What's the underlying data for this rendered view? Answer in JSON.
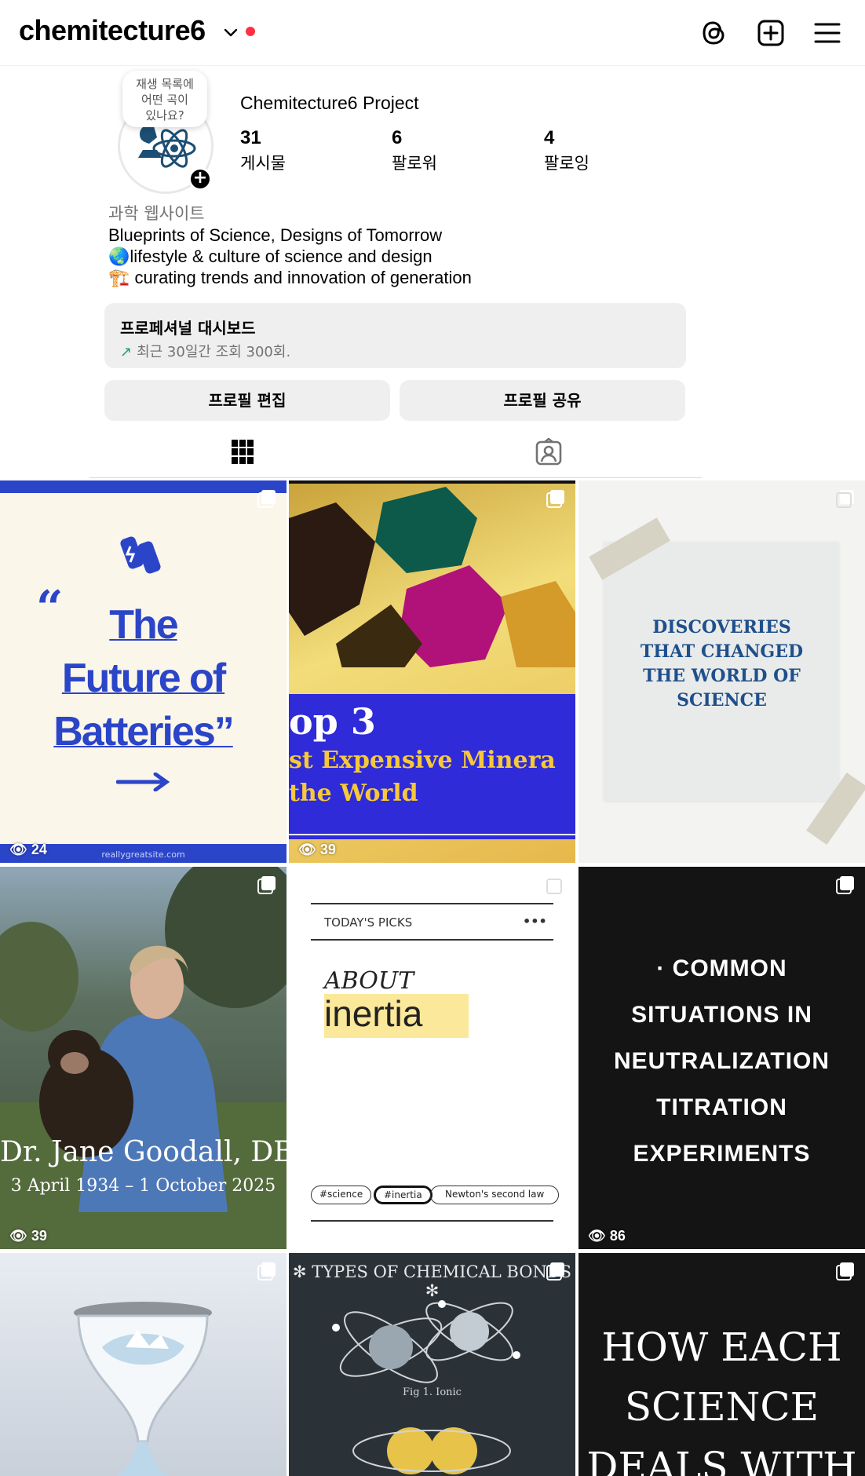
{
  "header": {
    "username": "chemitecture6",
    "icons": [
      "chevron-down-icon",
      "threads-icon",
      "create-icon",
      "menu-icon"
    ]
  },
  "profile": {
    "note": "재생 목록에\n어떤 곡이\n있나요?",
    "display_name": "Chemitecture6 Project",
    "stats": [
      {
        "value": "31",
        "label": "게시물"
      },
      {
        "value": "6",
        "label": "팔로워"
      },
      {
        "value": "4",
        "label": "팔로잉"
      }
    ],
    "category": "과학 웹사이트",
    "bio": [
      "Blueprints of Science, Designs of Tomorrow",
      "🌏lifestyle & culture of science and design",
      "🏗️ curating trends and innovation of generation"
    ]
  },
  "dashboard": {
    "title": "프로페셔널 대시보드",
    "subtitle": "최근 30일간 조회 300회."
  },
  "buttons": {
    "edit": "프로필 편집",
    "share": "프로필 공유"
  },
  "tabs": [
    "grid-icon",
    "tagged-icon"
  ],
  "posts": [
    {
      "views": "24",
      "lines": [
        "The",
        "Future of",
        "Batteries”"
      ],
      "quote": "“",
      "footer": "reallygreatsite.com"
    },
    {
      "views": "39",
      "lines": [
        "op 3",
        "st Expensive Minera",
        "the World"
      ]
    },
    {
      "views": "",
      "lines": [
        "DISCOVERIES",
        "THAT CHANGED",
        "THE WORLD OF",
        "SCIENCE"
      ]
    },
    {
      "views": "39",
      "lines": [
        "Dr. Jane Goodall, DBE",
        "3 April 1934 – 1 October 2025"
      ]
    },
    {
      "views": "",
      "kicker": "TODAY'S PICKS",
      "more": "•••",
      "about": "ABOUT",
      "word": "inertia",
      "tags": [
        "#science",
        "#inertia",
        "Newton's second law"
      ]
    },
    {
      "views": "86",
      "lines": [
        "· COMMON",
        "SITUATIONS IN",
        "NEUTRALIZATION",
        "TITRATION",
        "EXPERIMENTS"
      ]
    },
    {
      "views": "",
      "lines": []
    },
    {
      "views": "",
      "title": "TYPES OF CHEMICAL BONDS",
      "caption": "Fig 1. Ionic"
    },
    {
      "views": "",
      "lines": [
        "HOW EACH",
        "SCIENCE",
        "DEALS WITH"
      ]
    }
  ],
  "colors": {
    "notification_dot": "#ff3040",
    "battery_blue": "#2b45c9",
    "mineral_blue": "#2f2bd8",
    "dark_tile": "#141414",
    "bond_bg": "#2a3238"
  }
}
